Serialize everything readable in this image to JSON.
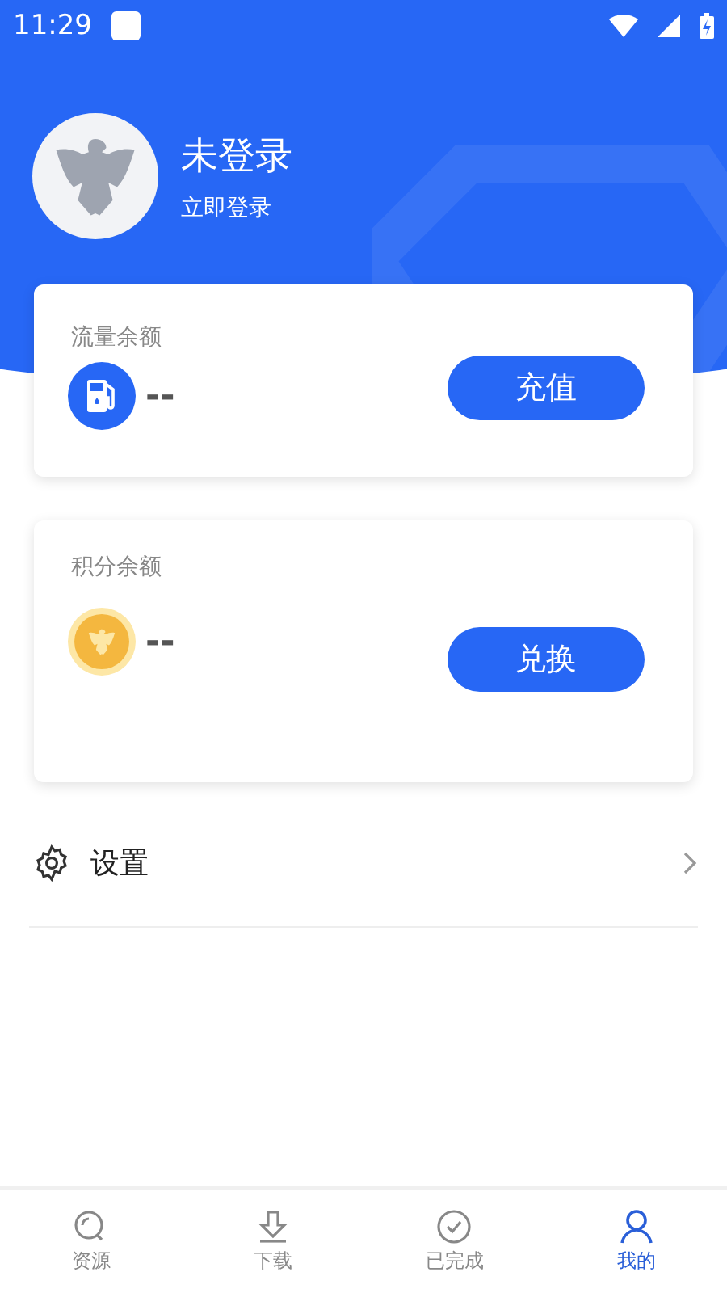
{
  "status_bar": {
    "time": "11:29"
  },
  "profile": {
    "name": "未登录",
    "action": "立即登录"
  },
  "balances": [
    {
      "kind": "traffic",
      "label": "流量余额",
      "value": "--",
      "button": "充值"
    },
    {
      "kind": "points",
      "label": "积分余额",
      "value": "--",
      "button": "兑换"
    }
  ],
  "menu": [
    {
      "label": "设置"
    }
  ],
  "tabs": [
    {
      "label": "资源",
      "selected": false
    },
    {
      "label": "下载",
      "selected": false
    },
    {
      "label": "已完成",
      "selected": false
    },
    {
      "label": "我的",
      "selected": true
    }
  ]
}
